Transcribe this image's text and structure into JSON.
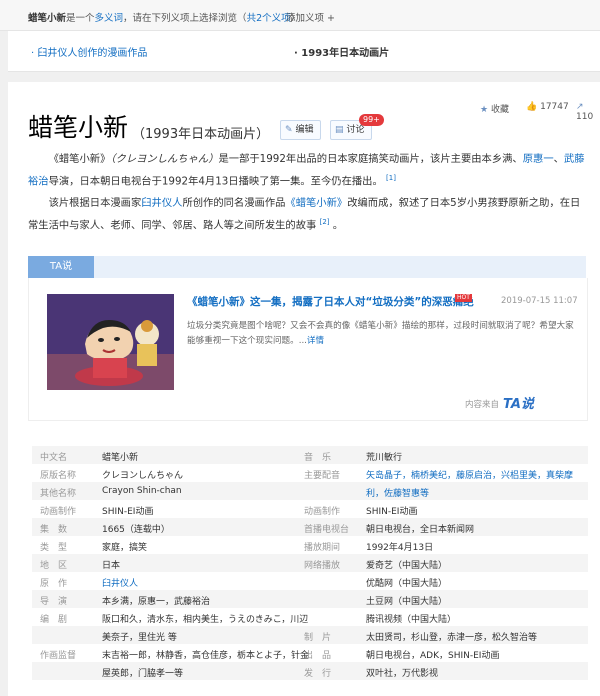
{
  "topbar": {
    "term": "蜡笔小新",
    "middle": "是一个",
    "polysemy": "多义词",
    "instruction": "，请在下列义项上选择浏览（",
    "count": "共2个义项",
    "close": "）",
    "add": "添加义项 +"
  },
  "disambiguation": {
    "option1": "· 臼井仪人创作的漫画作品",
    "option2": "· 1993年日本动画片"
  },
  "header": {
    "title": "蜡笔小新",
    "subtitle": "（1993年日本动画片）",
    "edit": "编辑",
    "discuss": "讨论",
    "discuss_badge": "99+",
    "collect": "收藏",
    "likes": "17747",
    "shares": "110"
  },
  "intro": {
    "p1a": "《蜡笔小新》",
    "p1b": "（クレヨンしんちゃん）",
    "p1c": "是一部于1992年出品的日本家庭搞笑动画片，该片主要由本乡满、",
    "director2": "原惠一",
    "sep": "、",
    "director3": "武藤裕治",
    "p1d": "导演，日本朝日电视台于1992年4月13日播映了第一集。至今仍在播出。",
    "ref1": "[1]",
    "p2a": "该片根据日本漫画家",
    "author": "臼井仪人",
    "p2b": "所创作的同名漫画作品",
    "work": "《蜡笔小新》",
    "p2c": "改编而成，叙述了日本5岁小男孩野原新之助，在日常生",
    "p2d": "活中与家人、老师、同学、邻居、路人等之间所发生的故事",
    "ref2": "[2]",
    "p2e": "。"
  },
  "ta": {
    "tab": "TA说",
    "article_title": "《蜡笔小新》这一集，揭露了日本人对“垃圾分类”的深恶痛绝",
    "hot": "HOT",
    "date": "2019-07-15 11:07",
    "desc": "垃圾分类究竟是图个啥呢？又会不会真的像《蜡笔小新》描绘的那样，过段时间就取消了呢？希望大家能够重视一下这个现实问题。...",
    "more": "详情",
    "source_label": "内容来自",
    "source_logo": "TA说"
  },
  "infobox": {
    "left": [
      {
        "k": "中文名",
        "v": "蜡笔小新"
      },
      {
        "k": "原版名称",
        "v": "クレヨンしんちゃん"
      },
      {
        "k": "其他名称",
        "v": "Crayon Shin-chan"
      },
      {
        "k": "动画制作",
        "v": "SHIN-EI动画"
      },
      {
        "k": "集　数",
        "v": "1665（连载中）"
      },
      {
        "k": "类　型",
        "v": "家庭，搞笑"
      },
      {
        "k": "地　区",
        "v": "日本"
      },
      {
        "k": "原　作",
        "v": "臼井仪人"
      },
      {
        "k": "导　演",
        "v": "本乡满，原惠一，武藤裕治"
      },
      {
        "k": "编　剧",
        "v": "阪口和久，清水东，相内美生，うえのきみこ，川辺",
        "v2": "美奈子，里住光 等"
      },
      {
        "k": "作画监督",
        "v": "末吉裕一郎，林静香，高仓佳彦，栃本とよ子，针金",
        "v2": "屋英郎，门脇孝一等"
      }
    ],
    "right": [
      {
        "k": "音　乐",
        "v": "荒川敏行"
      },
      {
        "k": "主要配音",
        "v": "矢岛晶子，楠桥美纪，藤原启治，兴梠里美，真柴摩",
        "v2": "利，佐藤智惠等"
      },
      {
        "k": "动画制作",
        "v": "SHIN-EI动画"
      },
      {
        "k": "首播电视台",
        "v": "朝日电视台，全日本新闻网"
      },
      {
        "k": "播放期间",
        "v": "1992年4月13日"
      },
      {
        "k": "网络播放",
        "v": "爱奇艺（中国大陆）"
      },
      {
        "k": "",
        "v": "优酷网（中国大陆）"
      },
      {
        "k": "",
        "v": "土豆网（中国大陆）"
      },
      {
        "k": "",
        "v": "腾讯视频（中国大陆）"
      },
      {
        "k": "制　片",
        "v": "太田贤司，杉山登，赤津一彦，松久智治等"
      },
      {
        "k": "出　品",
        "v": "朝日电视台，ADK，SHIN-EI动画"
      },
      {
        "k": "发　行",
        "v": "双叶社，万代影视"
      }
    ]
  }
}
